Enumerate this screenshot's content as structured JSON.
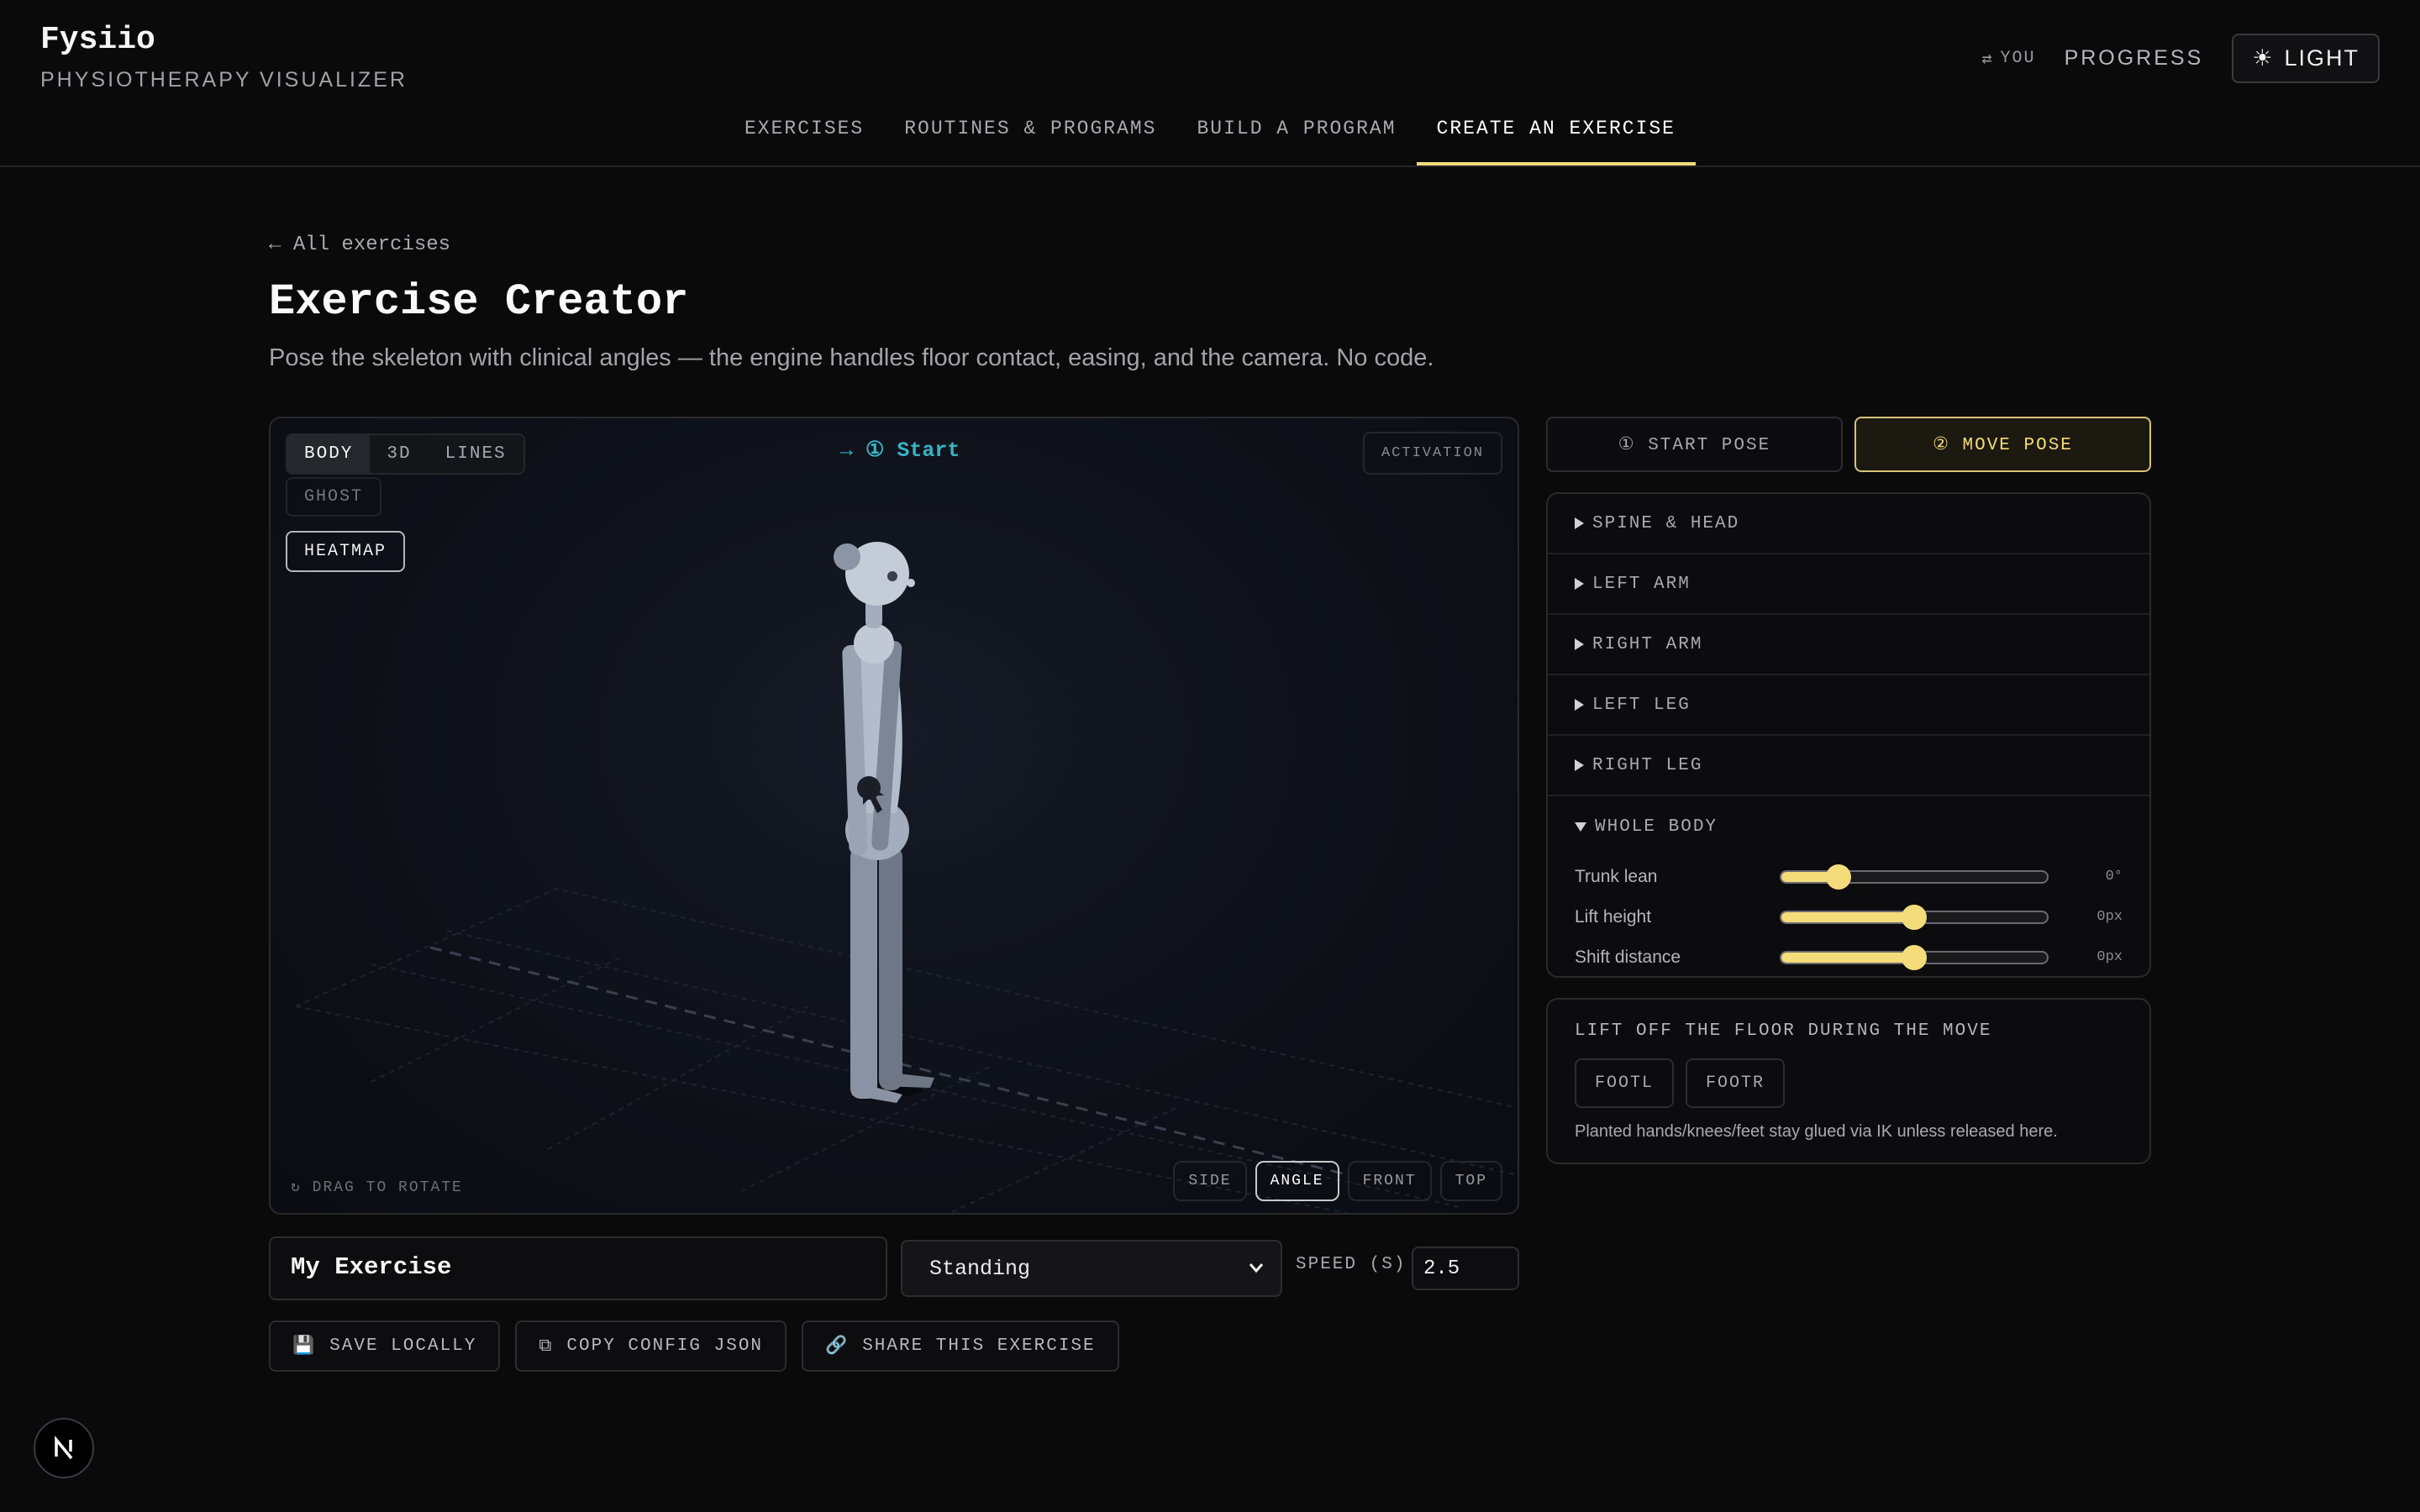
{
  "app": {
    "name": "Fysiio",
    "subtitle": "PHYSIOTHERAPY VISUALIZER"
  },
  "top_actions": {
    "you_label": "YOU",
    "progress_label": "PROGRESS",
    "theme_label": "LIGHT"
  },
  "nav": [
    {
      "label": "EXERCISES",
      "active": false
    },
    {
      "label": "ROUTINES & PROGRAMS",
      "active": false
    },
    {
      "label": "BUILD A PROGRAM",
      "active": false
    },
    {
      "label": "CREATE AN EXERCISE",
      "active": true
    }
  ],
  "page": {
    "back_label": "All exercises",
    "title": "Exercise Creator",
    "subtitle": "Pose the skeleton with clinical angles — the engine handles floor contact, easing, and the camera. No code."
  },
  "viewport": {
    "modes": [
      "BODY",
      "3D",
      "LINES"
    ],
    "active_mode": "BODY",
    "ghost_label": "GHOST",
    "heatmap_label": "HEATMAP",
    "phase_label": "→ ① Start",
    "activation_label": "ACTIVATION",
    "drag_hint": "↻ DRAG TO ROTATE",
    "cameras": [
      "SIDE",
      "ANGLE",
      "FRONT",
      "TOP"
    ],
    "active_camera": "ANGLE"
  },
  "form": {
    "exercise_name": "My Exercise",
    "position": "Standing",
    "speed_label": "SPEED (S)",
    "speed_value": "2.5"
  },
  "actions": {
    "save": "SAVE LOCALLY",
    "copy": "COPY CONFIG JSON",
    "share": "SHARE THIS EXERCISE"
  },
  "pose_tabs": [
    {
      "label": "① START POSE",
      "active": false
    },
    {
      "label": "② MOVE POSE",
      "active": true
    }
  ],
  "groups": [
    {
      "label": "SPINE & HEAD",
      "open": false
    },
    {
      "label": "LEFT ARM",
      "open": false
    },
    {
      "label": "RIGHT ARM",
      "open": false
    },
    {
      "label": "LEFT LEG",
      "open": false
    },
    {
      "label": "RIGHT LEG",
      "open": false
    },
    {
      "label": "WHOLE BODY",
      "open": true
    }
  ],
  "whole_body_sliders": [
    {
      "label": "Trunk lean",
      "value": "0°",
      "level": 0.22
    },
    {
      "label": "Lift height",
      "value": "0px",
      "level": 0.5
    },
    {
      "label": "Shift distance",
      "value": "0px",
      "level": 0.5
    }
  ],
  "lift": {
    "title": "LIFT OFF THE FLOOR DURING THE MOVE",
    "feet": [
      "FOOTL",
      "FOOTR"
    ],
    "note": "Planted hands/knees/feet stay glued via IK unless released here."
  },
  "colors": {
    "accent": "#f5dc7a",
    "phase": "#37b3c4",
    "background": "#0a0a0b"
  }
}
